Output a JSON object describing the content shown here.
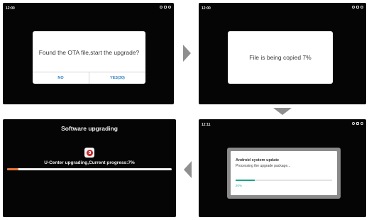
{
  "screens": {
    "s1": {
      "time": "12:00",
      "message": "Found the OTA file,start the upgrade?",
      "no_label": "NO",
      "yes_label": "YES(30)"
    },
    "s2": {
      "time": "12:00",
      "message": "File is being copied 7%"
    },
    "s3": {
      "title": "Software upgrading",
      "status_text": "U-Center upgrading,Current progress:7%",
      "progress_fraction": 0.07,
      "progress_color": "#e8763a"
    },
    "s4": {
      "time": "12:11",
      "dialog_title": "Android system update",
      "dialog_subtitle": "Processing the upgrade package...",
      "percent_text": "20%",
      "progress_fraction": 0.2,
      "progress_color": "#1ca48a"
    }
  },
  "status_icons": [
    "headphones-icon",
    "bluetooth-icon",
    "settings-icon"
  ],
  "arrow_color": "#8f8f8f"
}
